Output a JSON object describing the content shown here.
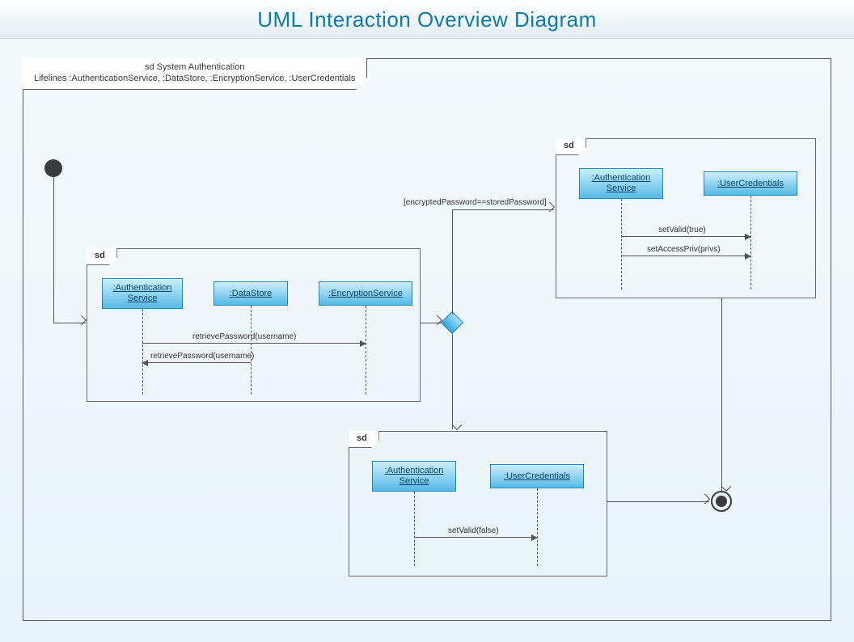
{
  "title": "UML Interaction Overview Diagram",
  "outer_frame": {
    "line1": "sd System Authentication",
    "line2": "Lifelines :AuthenticationService, :DataStore, :EncryptionService, :UserCredentials"
  },
  "sd1": {
    "tab": "sd",
    "ll": {
      "auth": ":Authentication\nService",
      "ds": ":DataStore",
      "enc": ":EncryptionService"
    },
    "msg1": "retrievePassword(username)",
    "msg2": "retrievePassword(username)"
  },
  "sd2": {
    "tab": "sd",
    "ll": {
      "auth": ":Authentication\nService",
      "uc": ":UserCredentials"
    },
    "msg1": "setValid(true)",
    "msg2": "setAccessPriv(privs)"
  },
  "sd3": {
    "tab": "sd",
    "ll": {
      "auth": ":Authentication\nService",
      "uc": ":UserCredentials"
    },
    "msg1": "setValid(false)"
  },
  "guard": "[encryptedPassword==storedPassword]"
}
